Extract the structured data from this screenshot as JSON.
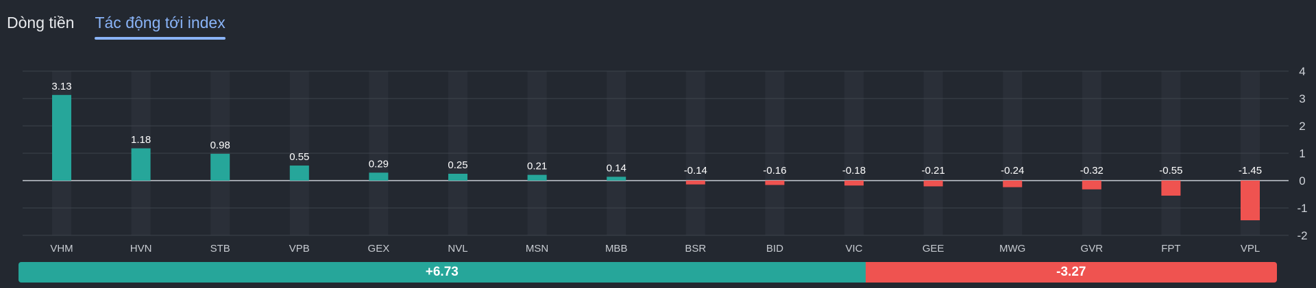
{
  "tabs": [
    {
      "label": "Dòng tiền",
      "active": false
    },
    {
      "label": "Tác động tới index",
      "active": true
    }
  ],
  "colors": {
    "positive": "#26a69a",
    "negative": "#ef5350",
    "tab_active": "#8ab4f8",
    "background": "#232830"
  },
  "chart_data": {
    "type": "bar",
    "categories": [
      "VHM",
      "HVN",
      "STB",
      "VPB",
      "GEX",
      "NVL",
      "MSN",
      "MBB",
      "BSR",
      "BID",
      "VIC",
      "GEE",
      "MWG",
      "GVR",
      "FPT",
      "VPL"
    ],
    "values": [
      3.13,
      1.18,
      0.98,
      0.55,
      0.29,
      0.25,
      0.21,
      0.14,
      -0.14,
      -0.16,
      -0.18,
      -0.21,
      -0.24,
      -0.32,
      -0.55,
      -1.45
    ],
    "ylim": [
      -2,
      4
    ],
    "yticks": [
      4,
      3,
      2,
      1,
      0,
      -1,
      -2
    ],
    "y_axis_side": "right",
    "grid": true,
    "data_labels": true
  },
  "totals": {
    "positive": "+6.73",
    "negative": "-3.27",
    "positive_value": 6.73,
    "negative_value": -3.27
  }
}
